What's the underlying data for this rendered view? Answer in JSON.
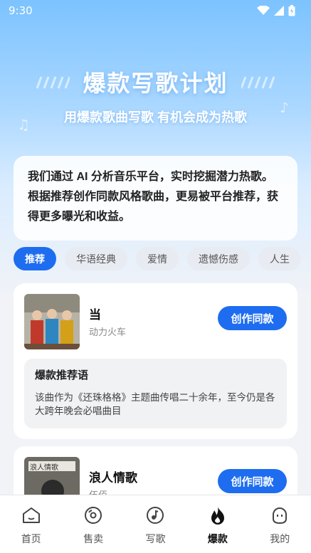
{
  "status": {
    "time": "9:30"
  },
  "hero": {
    "title": "爆款写歌计划",
    "subtitle": "用爆款歌曲写歌 有机会成为热歌"
  },
  "intro": {
    "text": "我们通过 AI 分析音乐平台，实时挖掘潜力热歌。根据推荐创作同款风格歌曲，更易被平台推荐，获得更多曝光和收益。"
  },
  "categories": [
    "推荐",
    "华语经典",
    "爱情",
    "遗憾伤感",
    "人生"
  ],
  "songs": [
    {
      "title": "当",
      "artist": "动力火车",
      "button": "创作同款",
      "rec_title": "爆款推荐语",
      "rec_text": "该曲作为《还珠格格》主题曲传唱二十余年，至今仍是各大跨年晚会必唱曲目"
    },
    {
      "title": "浪人情歌",
      "artist": "伍佰",
      "button": "创作同款",
      "cover_text": "浪人情歌"
    }
  ],
  "tabbar": [
    {
      "label": "首页",
      "icon": "home-icon"
    },
    {
      "label": "售卖",
      "icon": "vinyl-icon"
    },
    {
      "label": "写歌",
      "icon": "music-note-icon"
    },
    {
      "label": "爆款",
      "icon": "flame-icon"
    },
    {
      "label": "我的",
      "icon": "profile-icon"
    }
  ],
  "colors": {
    "accent": "#1e6df0",
    "hero_bg": "#7cc3ff"
  }
}
